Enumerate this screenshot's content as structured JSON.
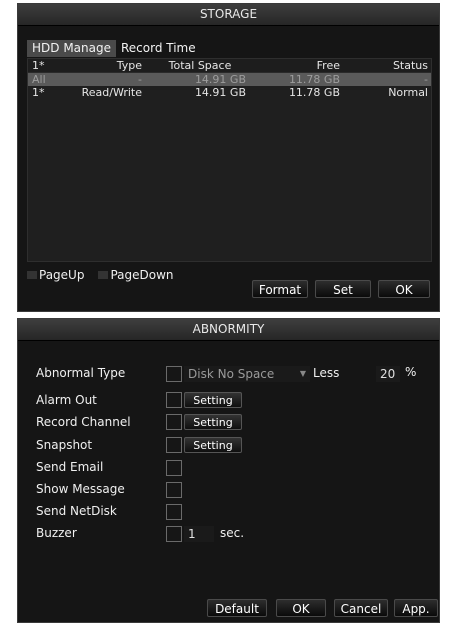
{
  "storage": {
    "title": "STORAGE",
    "tabs": [
      "HDD Manage",
      "Record Time"
    ],
    "columns": [
      "1*",
      "Type",
      "Total Space",
      "Free",
      "Status"
    ],
    "rows": [
      {
        "id": "All",
        "type": "-",
        "total": "14.91 GB",
        "free": "11.78 GB",
        "status": "-"
      },
      {
        "id": "1*",
        "type": "Read/Write",
        "total": "14.91 GB",
        "free": "11.78 GB",
        "status": "Normal"
      }
    ],
    "page_up": "PageUp",
    "page_down": "PageDown",
    "buttons": {
      "format": "Format",
      "set": "Set",
      "ok": "OK"
    }
  },
  "abnormity": {
    "title": "ABNORMITY",
    "labels": {
      "abnormal_type": "Abnormal Type",
      "alarm_out": "Alarm Out",
      "record_channel": "Record Channel",
      "snapshot": "Snapshot",
      "send_email": "Send Email",
      "show_message": "Show Message",
      "send_netdisk": "Send NetDisk",
      "buzzer": "Buzzer"
    },
    "abnormal_type_value": "Disk No Space",
    "less_label": "Less",
    "less_value": "20",
    "percent": "%",
    "setting_label": "Setting",
    "buzzer_value": "1",
    "buzzer_unit": "sec.",
    "buttons": {
      "default": "Default",
      "ok": "OK",
      "cancel": "Cancel",
      "apply": "App."
    }
  }
}
